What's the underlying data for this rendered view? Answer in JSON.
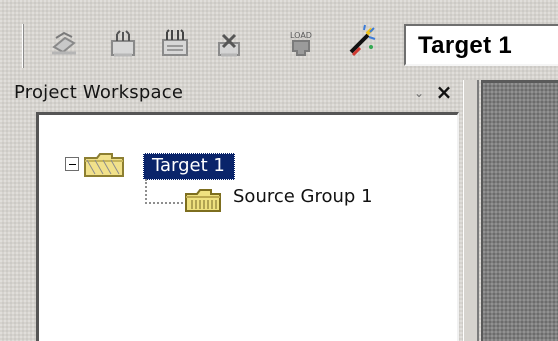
{
  "toolbar": {
    "target_value": "Target 1",
    "buttons": [
      {
        "name": "translate-icon"
      },
      {
        "name": "build-target-icon"
      },
      {
        "name": "rebuild-all-icon"
      },
      {
        "name": "stop-build-icon"
      },
      {
        "name": "download-icon"
      },
      {
        "name": "target-options-icon"
      }
    ]
  },
  "workspace": {
    "title": "Project Workspace",
    "menu_symbol": "⌄",
    "close_symbol": "×",
    "tree": {
      "root_label": "Target 1",
      "children": [
        {
          "label": "Source Group 1"
        }
      ]
    }
  },
  "colors": {
    "window_face": "#d6d3ce",
    "selection": "#0a246a",
    "tree_background": "#ffffff",
    "editor_gray": "#7f7f7f"
  }
}
